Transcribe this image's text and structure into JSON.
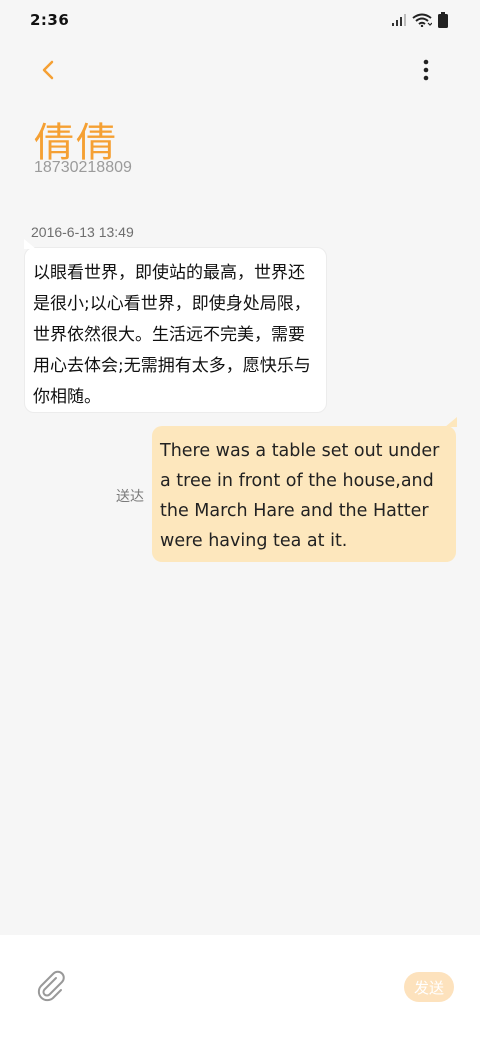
{
  "status_bar": {
    "time": "2:36",
    "icons": [
      "signal-icon",
      "wifi-icon",
      "battery-icon"
    ]
  },
  "header": {
    "back_icon": "chevron-left-icon",
    "more_icon": "more-vertical-icon",
    "contact_name": "倩倩",
    "contact_phone": "18730218809"
  },
  "conversation": {
    "timestamp": "2016-6-13 13:49",
    "messages": [
      {
        "direction": "incoming",
        "text": "以眼看世界，即使站的最高，世界还是很小;以心看世界，即使身处局限，世界依然很大。生活远不完美，需要用心去体会;无需拥有太多，愿快乐与你相随。"
      },
      {
        "direction": "outgoing",
        "status": "送达",
        "text": "There was a table set out under a tree in front of the house,and the March Hare and the Hatter were having tea at it."
      }
    ]
  },
  "composer": {
    "attach_icon": "paperclip-icon",
    "send_label": "发送"
  },
  "colors": {
    "accent": "#f5a033",
    "outgoing_bubble": "#fde7bd",
    "send_button_disabled": "#fde2bd"
  }
}
